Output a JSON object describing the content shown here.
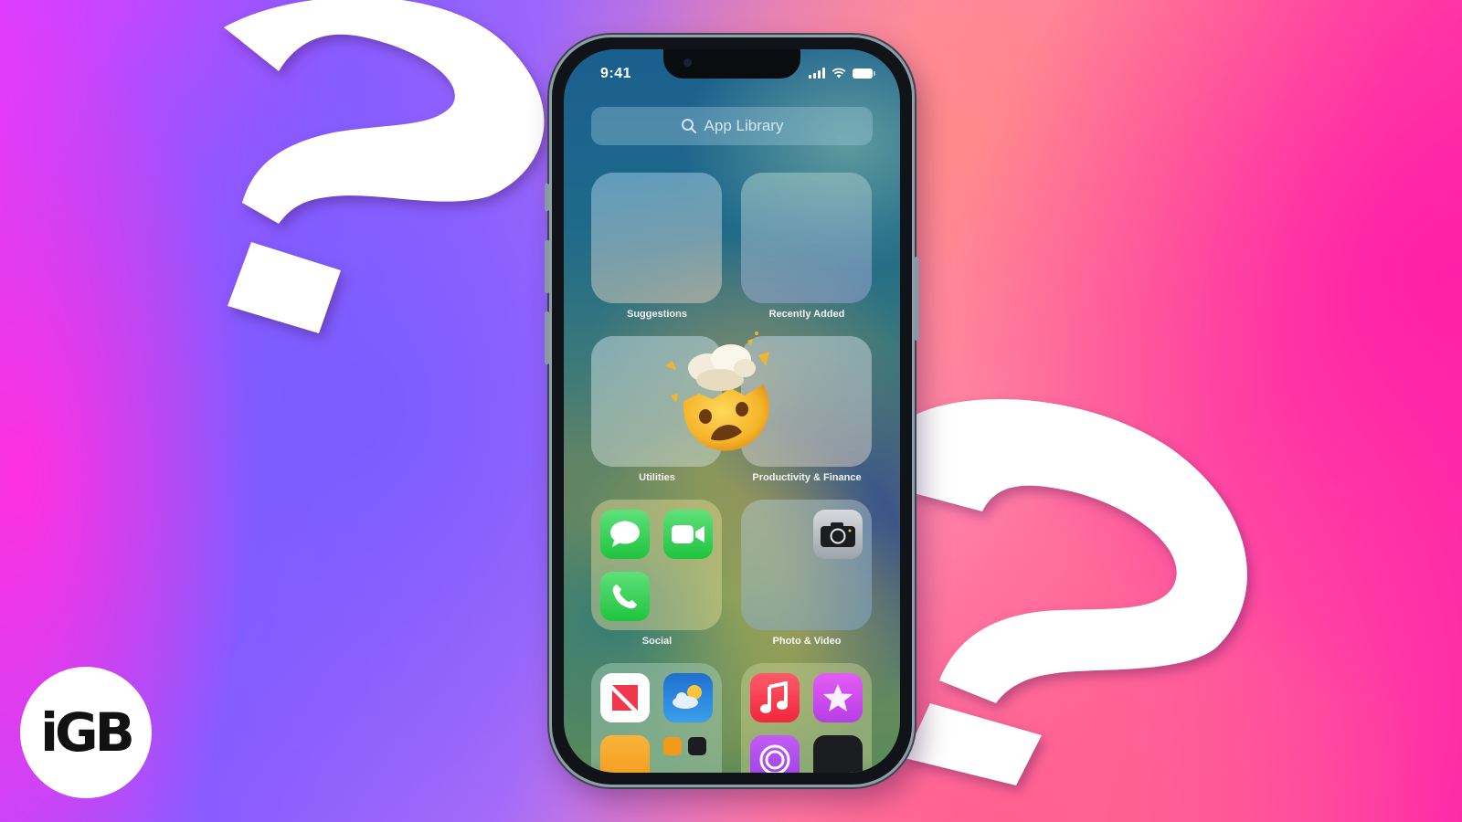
{
  "branding": {
    "logo_text": "iGB"
  },
  "status_bar": {
    "time": "9:41",
    "icons": [
      "cellular-signal-icon",
      "wifi-icon",
      "battery-icon"
    ]
  },
  "search": {
    "placeholder": "App Library",
    "icon": "search-icon"
  },
  "folders": [
    {
      "label": "Suggestions",
      "apps": []
    },
    {
      "label": "Recently Added",
      "apps": []
    },
    {
      "label": "Utilities",
      "apps": []
    },
    {
      "label": "Productivity & Finance",
      "apps": []
    },
    {
      "label": "Social",
      "apps": [
        "Messages",
        "FaceTime",
        "Phone"
      ]
    },
    {
      "label": "Photo & Video",
      "apps": [
        "Camera"
      ]
    },
    {
      "label": "",
      "apps": [
        "News",
        "Weather",
        "Contacts",
        "Books",
        "Stocks"
      ]
    },
    {
      "label": "",
      "apps": [
        "Music",
        "iTunes Store",
        "Podcasts",
        "Apple TV"
      ]
    }
  ],
  "overlay": {
    "emoji": "exploding-head-emoji"
  },
  "decorations": [
    "question-mark-left",
    "question-mark-right"
  ],
  "colors": {
    "messages_green": "#34c759",
    "music_red": "#fc3c44",
    "itunes_purple": "#d24cf0",
    "weather_blue": "#2f8ee0",
    "news_red": "#f0384b"
  }
}
